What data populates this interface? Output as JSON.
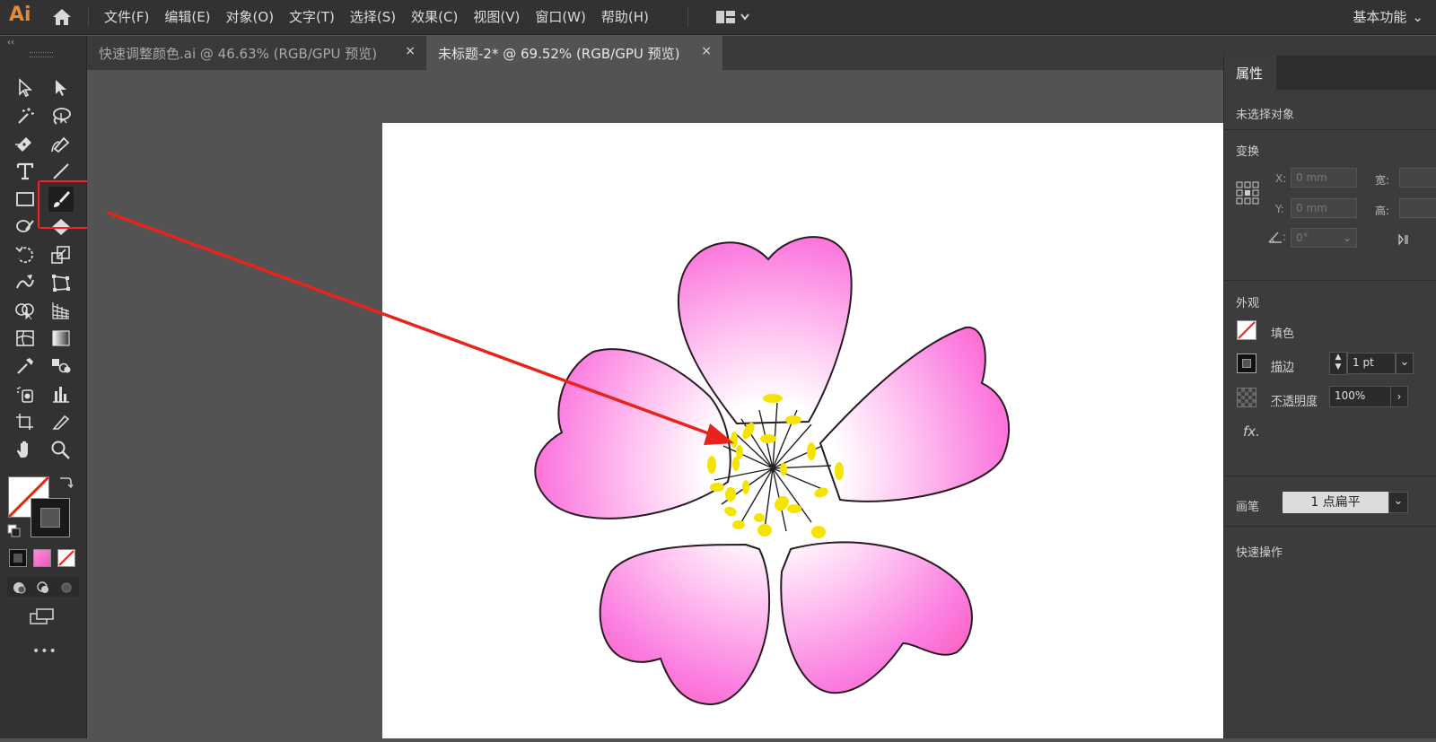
{
  "app": {
    "logo": "Ai",
    "workspace": "基本功能"
  },
  "menu": [
    "文件(F)",
    "编辑(E)",
    "对象(O)",
    "文字(T)",
    "选择(S)",
    "效果(C)",
    "视图(V)",
    "窗口(W)",
    "帮助(H)"
  ],
  "tabs": [
    {
      "label": "快速调整颜色.ai @ 46.63% (RGB/GPU 预览)",
      "close": "×"
    },
    {
      "label": "未标题-2* @ 69.52% (RGB/GPU 预览)",
      "close": "×"
    }
  ],
  "toolbar": {
    "collapse": "‹‹",
    "more": "•••",
    "active_tool": "paintbrush-tool"
  },
  "properties": {
    "tab": "属性",
    "no_selection": "未选择对象",
    "transform": {
      "title": "变换",
      "x_label": "X:",
      "x_value": "0 mm",
      "y_label": "Y:",
      "y_value": "0 mm",
      "w_label": "宽:",
      "h_label": "高:",
      "angle_label": ":",
      "angle_value": "0°"
    },
    "appearance": {
      "title": "外观",
      "fill_label": "填色",
      "stroke_label": "描边",
      "stroke_value": "1 pt",
      "opacity_label": "不透明度",
      "opacity_value": "100%",
      "fx_label": "fx."
    },
    "brush": {
      "label": "画笔",
      "value": "1 点扁平"
    },
    "quick_actions": "快速操作"
  },
  "colors": {
    "accent_highlight": "#ff1e1e",
    "arrow": "#e8231c",
    "petal_pink": "#ff66cc",
    "stamen_yellow": "#f5e400"
  }
}
